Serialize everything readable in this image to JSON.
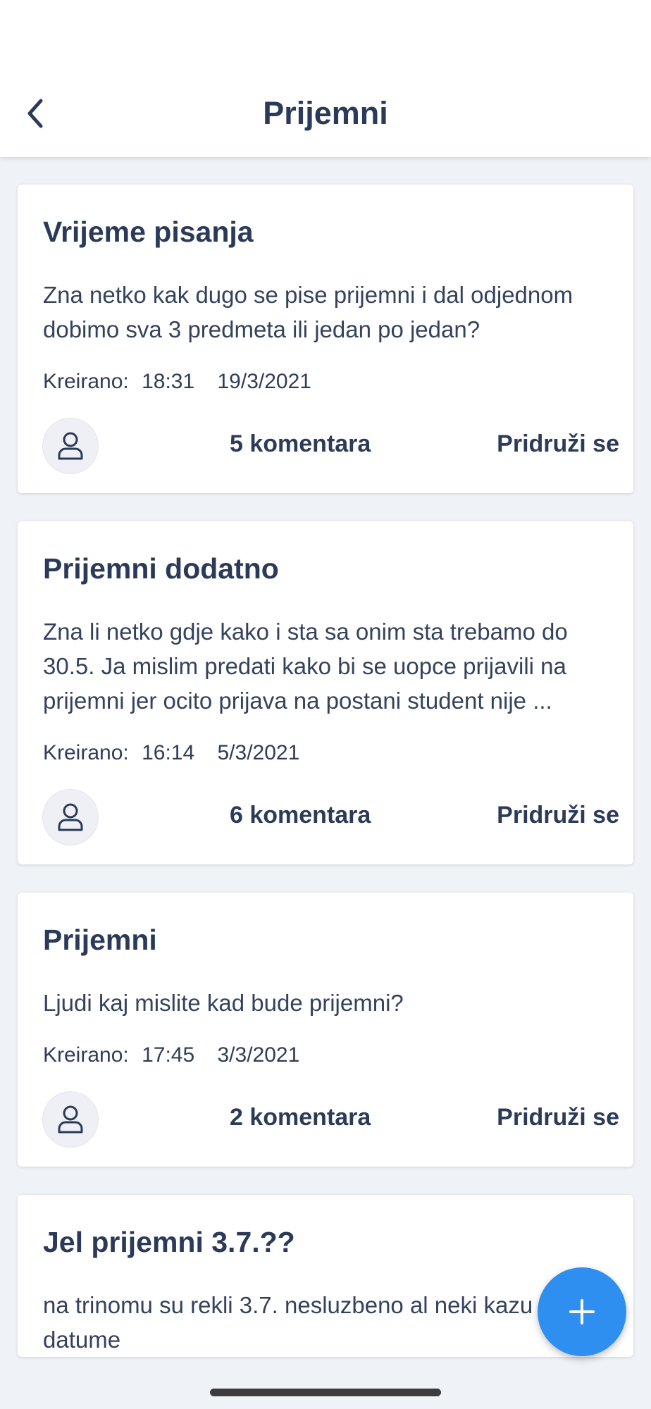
{
  "header": {
    "title": "Prijemni",
    "back_icon": "chevron-left-icon"
  },
  "posts": [
    {
      "title": "Vrijeme pisanja",
      "body": "Zna netko kak dugo se pise prijemni i dal odjednom dobimo sva 3 predmeta ili jedan po jedan?",
      "created_label": "Kreirano:",
      "time": "18:31",
      "date": "19/3/2021",
      "comments": "5 komentara",
      "join": "Pridruži se"
    },
    {
      "title": "Prijemni dodatno",
      "body": "Zna li netko gdje kako i sta sa onim sta trebamo do 30.5. Ja mislim predati kako bi se uopce prijavili na prijemni jer ocito prijava na postani student nije ...",
      "created_label": "Kreirano:",
      "time": "16:14",
      "date": "5/3/2021",
      "comments": "6 komentara",
      "join": "Pridruži se"
    },
    {
      "title": "Prijemni",
      "body": "Ljudi kaj mislite kad bude prijemni?",
      "created_label": "Kreirano:",
      "time": "17:45",
      "date": "3/3/2021",
      "comments": "2 komentara",
      "join": "Pridruži se"
    },
    {
      "title": "Jel prijemni 3.7.??",
      "body": "na trinomu su rekli 3.7. nesluzbeno al neki kazu druga datume"
    }
  ],
  "fab": {
    "icon": "plus-icon"
  },
  "colors": {
    "background": "#eff2f6",
    "text_primary": "#2a3a58",
    "accent": "#2e8ff0",
    "card": "#ffffff"
  }
}
